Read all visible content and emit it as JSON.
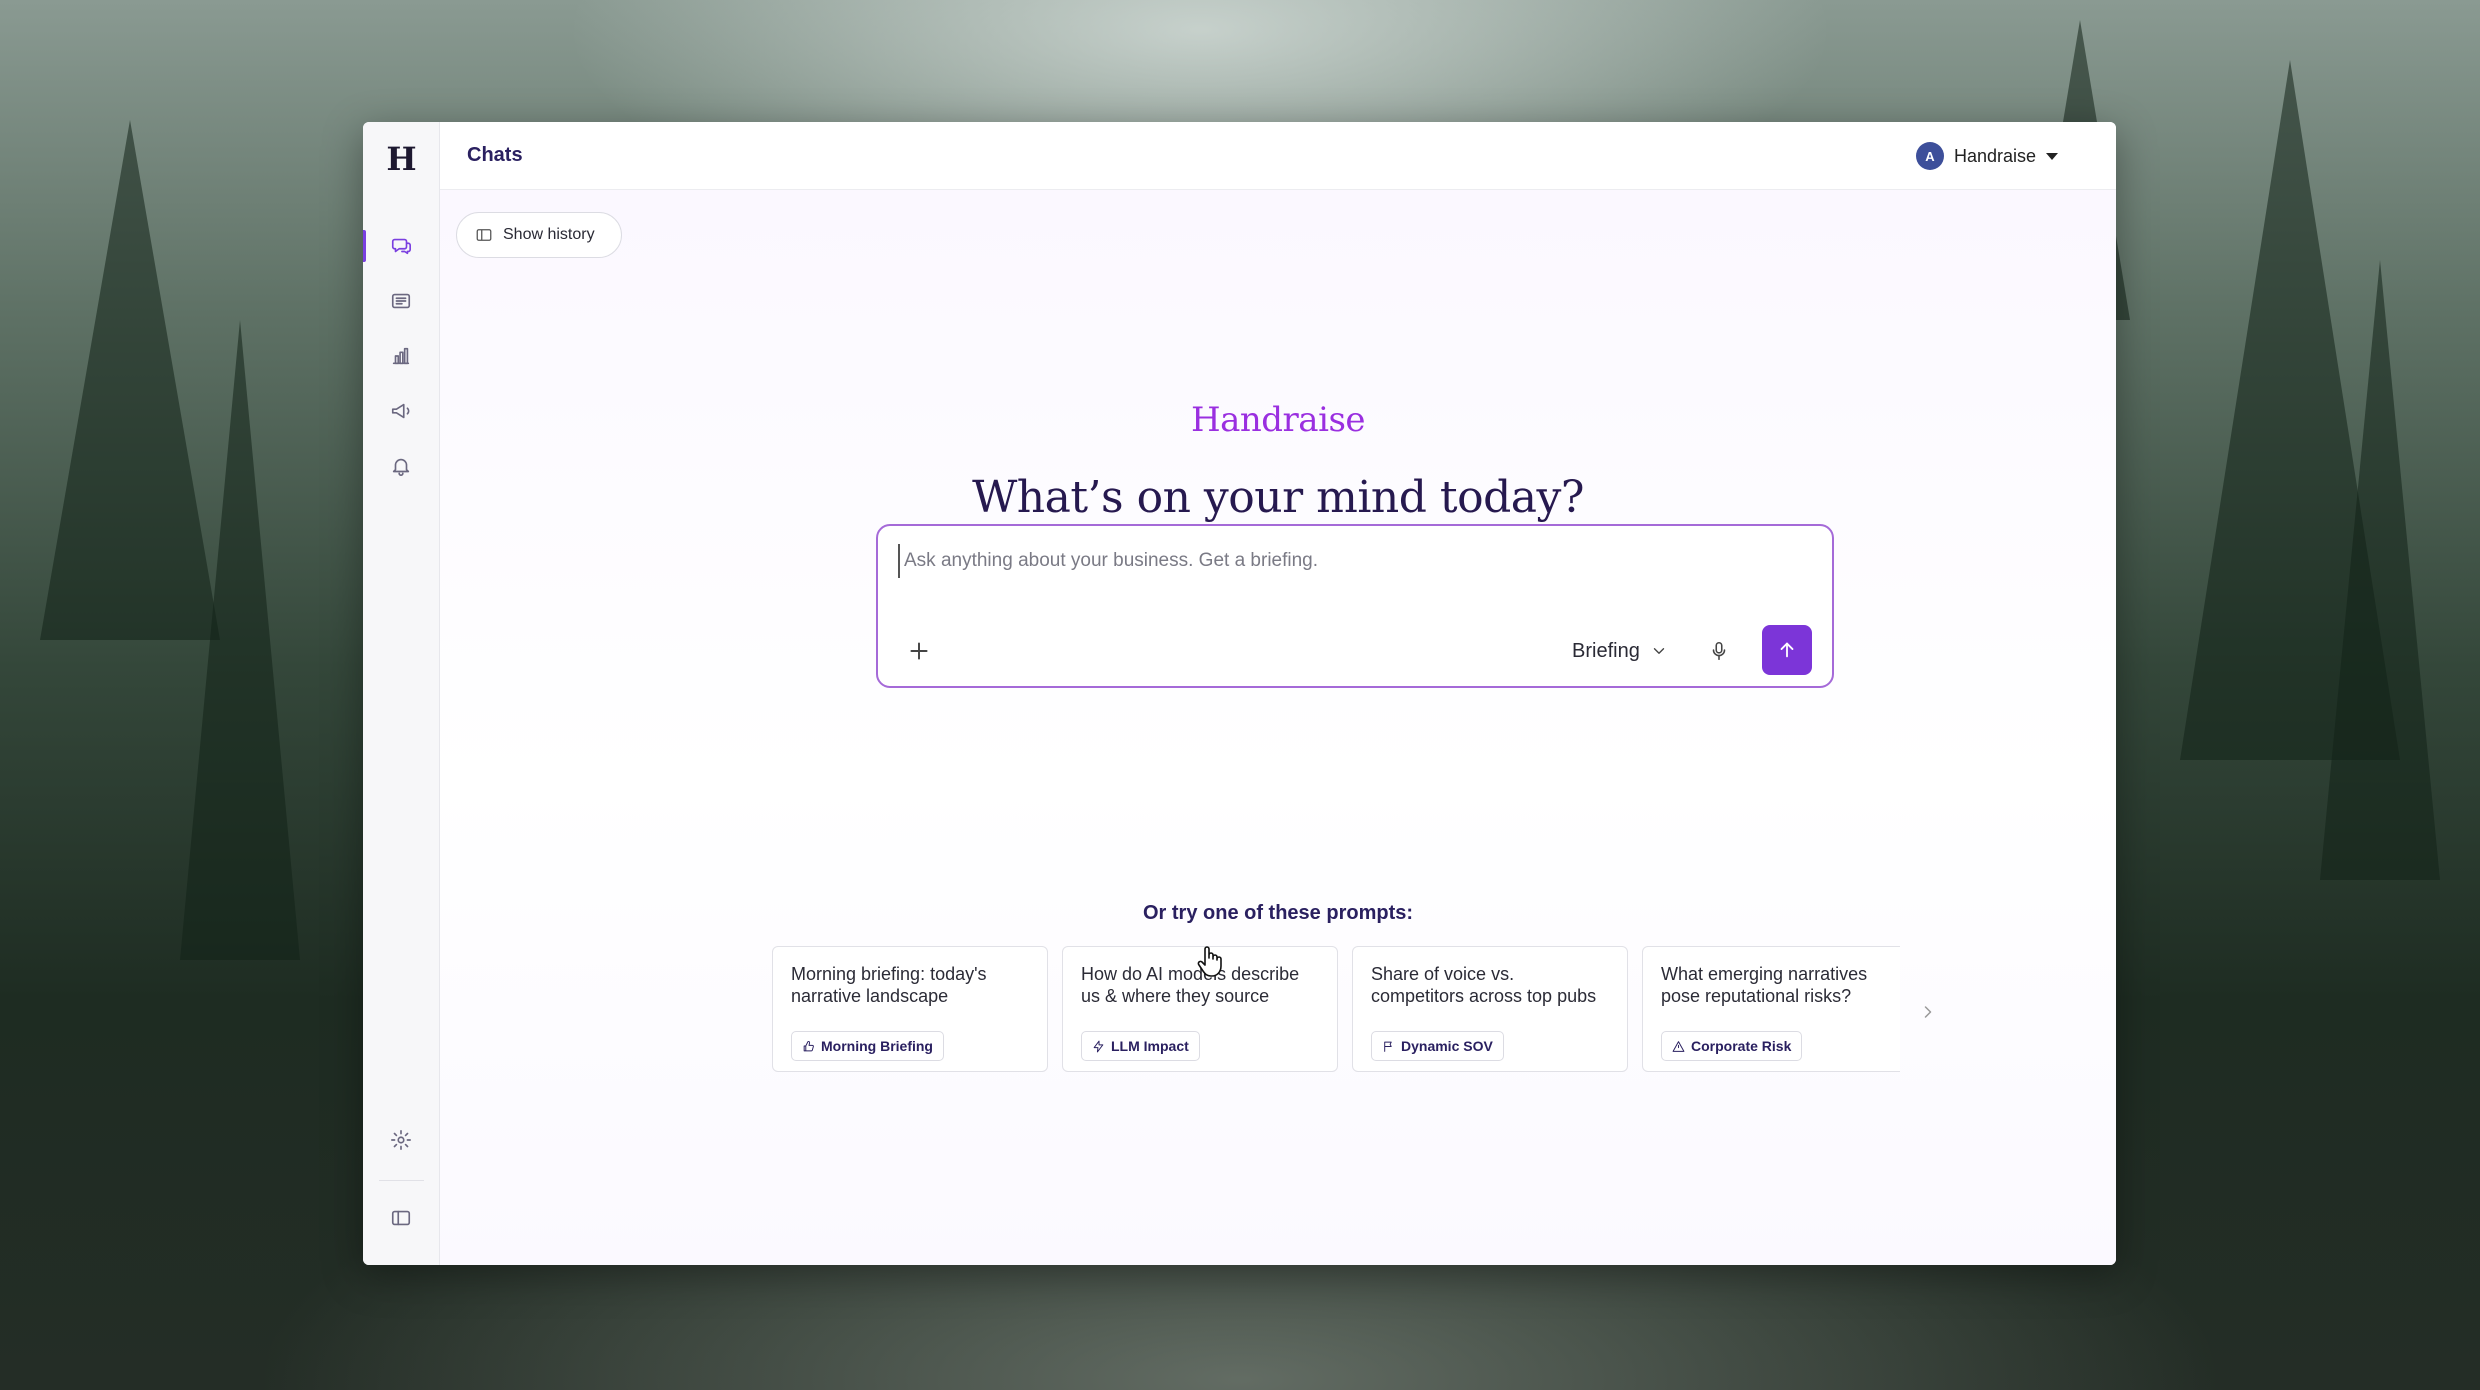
{
  "sidebar": {
    "logo": "H",
    "items": [
      {
        "icon": "chat-bubbles-icon",
        "active": true
      },
      {
        "icon": "newspaper-icon",
        "active": false
      },
      {
        "icon": "bar-chart-icon",
        "active": false
      },
      {
        "icon": "megaphone-icon",
        "active": false
      },
      {
        "icon": "bell-icon",
        "active": false
      }
    ],
    "bottom_items": [
      {
        "icon": "gear-icon"
      },
      {
        "icon": "sidebar-toggle-icon"
      }
    ]
  },
  "header": {
    "title": "Chats",
    "account": {
      "avatar_initial": "A",
      "name": "Handraise"
    }
  },
  "main": {
    "history_button": "Show history",
    "brand": "Handraise",
    "headline": "What’s on your mind today?",
    "composer": {
      "placeholder": "Ask anything about your business. Get a briefing.",
      "mode": "Briefing",
      "send_icon": "arrow-up-icon",
      "mic_icon": "microphone-icon",
      "add_icon": "plus-icon"
    },
    "prompts_label": "Or try one of these prompts:",
    "prompts": [
      {
        "text": "Morning briefing: today's narrative landscape",
        "tag": "Morning Briefing",
        "tag_icon": "thumbs-up-icon"
      },
      {
        "text": "How do AI models describe us & where they source",
        "tag": "LLM Impact",
        "tag_icon": "lightning-icon"
      },
      {
        "text": "Share of voice vs. competitors across top pubs",
        "tag": "Dynamic SOV",
        "tag_icon": "flag-icon"
      },
      {
        "text": "What emerging narratives pose reputational risks?",
        "tag": "Corporate Risk",
        "tag_icon": "warning-triangle-icon"
      }
    ]
  },
  "colors": {
    "accent": "#7c35d8",
    "brand": "#9a2fe0",
    "heading": "#26194f"
  }
}
